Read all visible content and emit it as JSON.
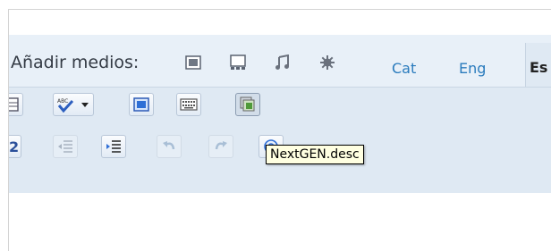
{
  "media_bar": {
    "label": "Añadir medios:",
    "icons": [
      "image-icon",
      "gallery-icon",
      "music-icon",
      "star-icon"
    ]
  },
  "language_tabs": [
    {
      "label": "Cat"
    },
    {
      "label": "Eng"
    },
    {
      "label": "Es"
    }
  ],
  "tooltip": {
    "text": "NextGEN.desc"
  },
  "colors": {
    "media_bar_bg": "#e8f0f8",
    "toolbar_bg": "#dfe9f3",
    "link_blue": "#2a7bbd",
    "tooltip_bg": "#ffffe1"
  }
}
